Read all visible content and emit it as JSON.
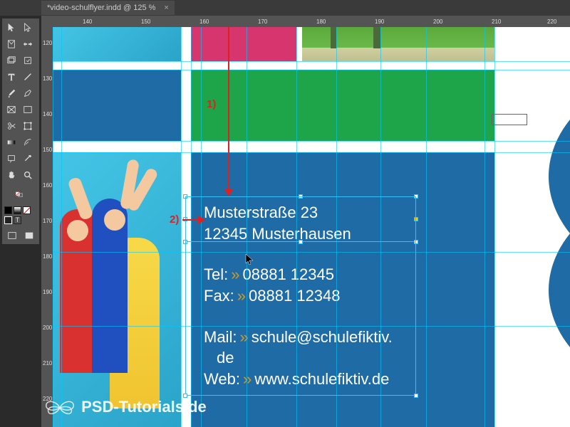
{
  "titlebar": {
    "tab_title": "*video-schulflyer.indd @ 125 %",
    "close": "×"
  },
  "ruler": {
    "h": [
      "140",
      "150",
      "160",
      "170",
      "180",
      "190",
      "200",
      "210",
      "220"
    ],
    "v": [
      "120",
      "130",
      "140",
      "150",
      "160",
      "170",
      "180",
      "190",
      "200",
      "210",
      "220"
    ]
  },
  "annotations": {
    "a1": "1)",
    "a2": "2)"
  },
  "contact": {
    "street": "Musterstraße 23",
    "city": "12345 Musterhausen",
    "tel_label": "Tel:",
    "tel_value": "08881 12345",
    "fax_label": "Fax:",
    "fax_value": "08881 12348",
    "mail_label": "Mail:",
    "mail_value": "schule@schulefiktiv.",
    "mail_value2": "de",
    "web_label": "Web:",
    "web_value": "www.schulefiktiv.de"
  },
  "watermark": "PSD-Tutorials.de",
  "tools": {
    "selection": "selection",
    "direct": "direct-selection",
    "page": "page",
    "gap": "gap",
    "content": "content-collector",
    "place": "content-placer",
    "type": "type",
    "line": "line",
    "pen": "pen",
    "pencil": "pencil",
    "frame": "rectangle-frame",
    "rect": "rectangle",
    "scissors": "scissors",
    "transform": "free-transform",
    "gradient-swatch": "gradient-swatch",
    "feather": "gradient-feather",
    "note": "note",
    "eyedrop": "eyedropper",
    "hand": "hand",
    "zoom": "zoom"
  }
}
